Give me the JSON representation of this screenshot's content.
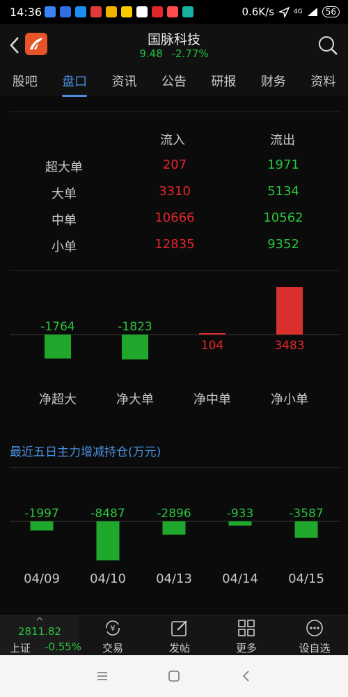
{
  "status_bar": {
    "time": "14:36",
    "network_speed": "0.6K/s",
    "network_type": "4G",
    "battery": "56"
  },
  "header": {
    "stock_name": "国脉科技",
    "price": "9.48",
    "change_pct": "-2.77%",
    "quote_color": "#23c041"
  },
  "tabs": [
    {
      "label": "股吧"
    },
    {
      "label": "盘口",
      "active": true
    },
    {
      "label": "资讯"
    },
    {
      "label": "公告"
    },
    {
      "label": "研报"
    },
    {
      "label": "财务"
    },
    {
      "label": "资料"
    }
  ],
  "flow_table": {
    "col_in": "流入",
    "col_out": "流出",
    "rows": [
      {
        "label": "超大单",
        "in": "207",
        "out": "1971"
      },
      {
        "label": "大单",
        "in": "3310",
        "out": "5134"
      },
      {
        "label": "中单",
        "in": "10666",
        "out": "10562"
      },
      {
        "label": "小单",
        "in": "12835",
        "out": "9352"
      }
    ]
  },
  "chart_data": [
    {
      "type": "bar",
      "categories": [
        "净超大",
        "净大单",
        "净中单",
        "净小单"
      ],
      "values": [
        -1764,
        -1823,
        104,
        3483
      ],
      "value_labels": [
        "-1764",
        "-1823",
        "104",
        "3483"
      ],
      "positive_color": "#d9302e",
      "negative_color": "#1fa82c"
    },
    {
      "type": "bar",
      "title": "最近五日主力增减持仓(万元)",
      "categories": [
        "04/09",
        "04/10",
        "04/13",
        "04/14",
        "04/15"
      ],
      "values": [
        -1997,
        -8487,
        -2896,
        -933,
        -3587
      ],
      "value_labels": [
        "-1997",
        "-8487",
        "-2896",
        "-933",
        "-3587"
      ],
      "negative_color": "#1fa82c"
    }
  ],
  "bottom_nav": {
    "index_value": "2811.82",
    "index_name": "上证",
    "index_change": "-0.55%",
    "items": [
      {
        "label": "交易",
        "icon": "trade-icon"
      },
      {
        "label": "发帖",
        "icon": "compose-icon"
      },
      {
        "label": "更多",
        "icon": "grid-icon"
      },
      {
        "label": "设自选",
        "icon": "more-dots-icon"
      }
    ]
  }
}
